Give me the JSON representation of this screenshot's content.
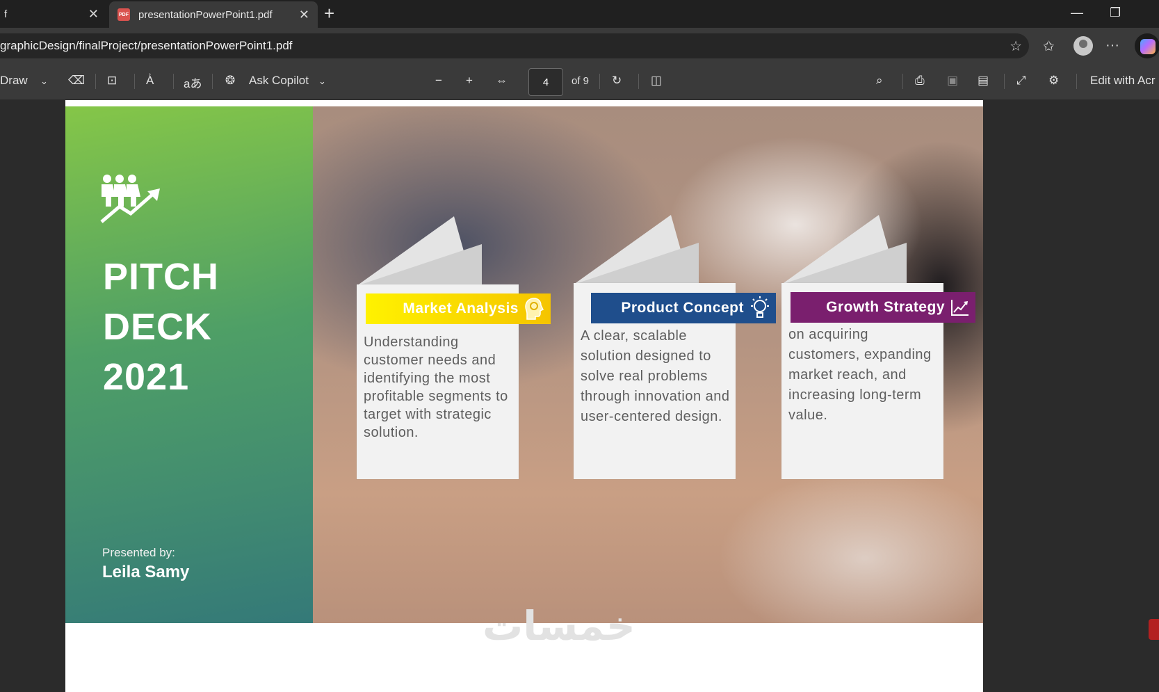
{
  "tabs": {
    "inactive_label": "f",
    "active_label": "presentationPowerPoint1.pdf",
    "pdf_badge": "PDF"
  },
  "address": {
    "url": "graphicDesign/finalProject/presentationPowerPoint1.pdf"
  },
  "toolbar": {
    "draw_label": "Draw",
    "ask_copilot_label": "Ask Copilot",
    "page_number": "4",
    "page_total": "of 9",
    "edit_label": "Edit with Acr"
  },
  "slide": {
    "title_line1": "PITCH",
    "title_line2": "DECK",
    "title_line3": "2021",
    "presented_by": "Presented by:",
    "author": "Leila Samy",
    "cards": [
      {
        "title": "Market Analysis",
        "body": "Understanding customer needs and identifying the most profitable segments to target with strategic solution.",
        "color": "#f5d40a",
        "icon": "head-gear-icon"
      },
      {
        "title": "Product Concept",
        "body": "A clear, scalable solution designed to solve real problems through innovation and user-centered design.",
        "color": "#1f4e8c",
        "icon": "lightbulb-icon"
      },
      {
        "title": "Growth Strategy",
        "body": "on acquiring customers, expanding market reach, and increasing long-term value.",
        "color": "#7a1f6e",
        "icon": "chart-line-icon"
      }
    ]
  },
  "watermark": "خمسات",
  "colors": {
    "panel_green": "#84c846",
    "panel_teal": "#2d7878",
    "chrome_dark": "#202020",
    "toolbar": "#3a3a3a"
  }
}
